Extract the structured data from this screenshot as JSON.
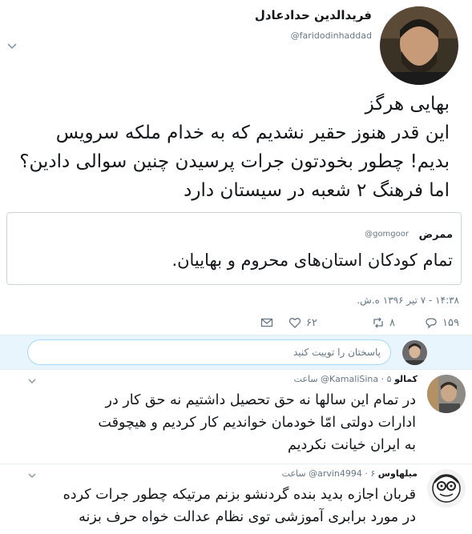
{
  "tweet": {
    "author_name": "فریدالدین حدادعادل",
    "author_handle": "@faridodinhaddad",
    "lines": [
      "بهایی هرگز",
      "این قدر هنوز حقیر نشدیم که به خدام ملکه سرویس",
      "بدیم! چطور بخودتون جرات پرسیدن چنین سوالی دادین؟",
      "اما فرهنگ ۲ شعبه در سیستان دارد"
    ],
    "timestamp": "۱۴:۳۸ - ۷ تیر ۱۳۹۶ ه.ش.",
    "quote": {
      "name": "ممرض",
      "handle": "@gomgoor",
      "text": "تمام کودکان استان‌های محروم و بهاییان."
    },
    "actions": {
      "reply_count": "۱۵۹",
      "retweet_count": "۸",
      "like_count": "۶۲"
    }
  },
  "composer": {
    "placeholder": "پاسختان را توییت کنید"
  },
  "replies": [
    {
      "name": "کمالو",
      "handle": "@KamaliSina",
      "time": "۵ ساعت",
      "lines": [
        "در تمام این سالها نه حق تحصیل داشتیم نه حق کار در",
        "ادارات دولتی امّا خودمان خواندیم کار کردیم و هیچوقت",
        "به ایران خیانت نکردیم"
      ]
    },
    {
      "name": "میلهاوس",
      "handle": "@arvin4994",
      "time": "۶ ساعت",
      "lines": [
        "قربان اجازه بدید بنده گردنشو بزنم مرتیکه چطور جرات کرده",
        "در مورد برابری آموزشی توی نظام عدالت خواه حرف بزنه"
      ]
    }
  ]
}
